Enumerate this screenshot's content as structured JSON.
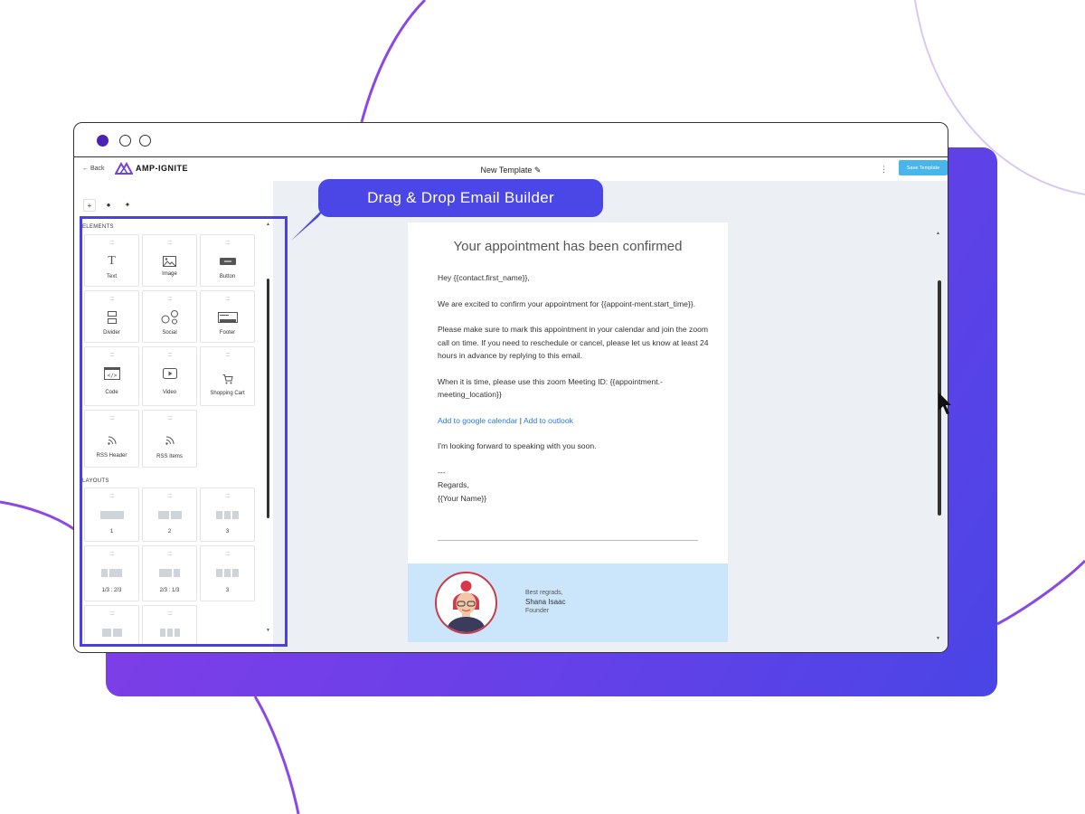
{
  "window": {
    "back_label": "← Back",
    "logo_text": "AMP-IGNITE",
    "template_title": "New Template ✎",
    "save_label": "Save Template",
    "menu_glyph": "⋮"
  },
  "panel": {
    "tabs": [
      "+",
      "●",
      "✦"
    ],
    "elements_label": "ELEMENTS",
    "layouts_label": "LAYOUTS",
    "grip": "::::",
    "elements": [
      {
        "label": "Text",
        "icon": "text-icon"
      },
      {
        "label": "Image",
        "icon": "image-icon"
      },
      {
        "label": "Button",
        "icon": "button-icon"
      },
      {
        "label": "Divider",
        "icon": "divider-icon"
      },
      {
        "label": "Social",
        "icon": "social-icon"
      },
      {
        "label": "Footer",
        "icon": "footer-icon"
      },
      {
        "label": "Code",
        "icon": "code-icon"
      },
      {
        "label": "Video",
        "icon": "video-icon"
      },
      {
        "label": "Shopping Cart",
        "icon": "cart-icon"
      },
      {
        "label": "RSS Header",
        "icon": "rss-icon"
      },
      {
        "label": "RSS Items",
        "icon": "rss-icon"
      }
    ],
    "layouts": [
      {
        "label": "1"
      },
      {
        "label": "2"
      },
      {
        "label": "3"
      },
      {
        "label": "1/3 : 2/3"
      },
      {
        "label": "2/3 : 1/3"
      },
      {
        "label": "3"
      }
    ]
  },
  "callout": {
    "text": "Drag & Drop Email Builder"
  },
  "email": {
    "title": "Your appointment has been confirmed",
    "greeting": "Hey {{contact.first_name}},",
    "p1": "We are excited to confirm your appointment for  {{appoint-ment.start_time}}.",
    "p2": "Please make sure to mark this appointment in your calendar and join the zoom call on time. If you need to reschedule or cancel, please let us know at least 24 hours in advance by replying to this email.",
    "p3": "When it is time, please use this zoom Meeting ID: {{appointment.-meeting_location}}",
    "link_google": "Add to google calendar",
    "link_sep": " | ",
    "link_outlook": "Add to outlook",
    "p4": "I'm looking forward to speaking with you soon.",
    "sep": "---",
    "regards": "Regards,",
    "your_name": "{{Your Name}}"
  },
  "signature": {
    "best": "Best regrads,",
    "name": "Shana Isaac",
    "role": "Founder"
  },
  "colors": {
    "accent": "#4a47e6",
    "save_button": "#4ab5ea",
    "signature_bg": "#cbe6fb",
    "link": "#2f78d6"
  }
}
